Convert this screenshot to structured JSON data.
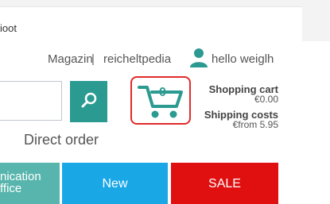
{
  "topbar": {
    "text": "ioot"
  },
  "nav": {
    "magazin": "Magazin",
    "separator": "|",
    "reicheltpedia": "reicheltpedia",
    "user_greeting": "hello weiglh"
  },
  "search": {
    "value": "",
    "placeholder": ""
  },
  "direct_order": "Direct order",
  "cart": {
    "count": "0",
    "title": "Shopping cart",
    "total": "€0.00",
    "shipping_label": "Shipping costs",
    "shipping_value": "€from 5.95"
  },
  "tiles": {
    "communication_line1": "nication",
    "communication_line2": "ffice",
    "new": "New",
    "sale": "SALE"
  },
  "colors": {
    "teal": "#2b9a91",
    "light_teal": "#58b5ad",
    "blue": "#1aa7e6",
    "red": "#e01010",
    "cart_border": "#e02b2b"
  }
}
